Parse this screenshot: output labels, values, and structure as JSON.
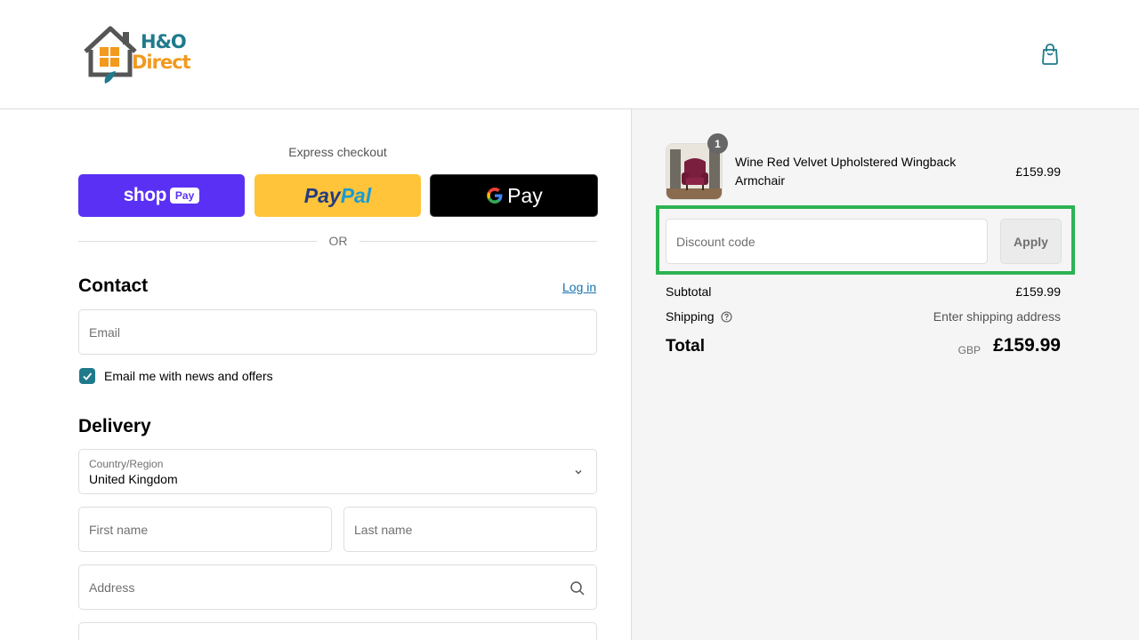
{
  "brand": {
    "line1": "H&O",
    "line2": "Direct",
    "colors": {
      "primary": "#1f7a8c",
      "accent": "#f29a1f"
    }
  },
  "header": {
    "cart_icon": "shopping-bag-icon"
  },
  "express": {
    "label": "Express checkout",
    "shop_pay": {
      "word": "shop",
      "badge": "Pay"
    },
    "paypal": {
      "part1": "Pay",
      "part2": "Pal"
    },
    "gpay": {
      "g": "G",
      "word": "Pay"
    },
    "divider": "OR"
  },
  "contact": {
    "title": "Contact",
    "login_link": "Log in",
    "email_placeholder": "Email",
    "newsletter_label": "Email me with news and offers",
    "newsletter_checked": true
  },
  "delivery": {
    "title": "Delivery",
    "country_label": "Country/Region",
    "country_value": "United Kingdom",
    "first_name_placeholder": "First name",
    "last_name_placeholder": "Last name",
    "address_placeholder": "Address"
  },
  "order": {
    "item": {
      "quantity": "1",
      "name": "Wine Red Velvet Upholstered Wingback Armchair",
      "price": "£159.99"
    },
    "discount": {
      "placeholder": "Discount code",
      "apply_label": "Apply"
    },
    "subtotal": {
      "label": "Subtotal",
      "value": "£159.99"
    },
    "shipping": {
      "label": "Shipping",
      "value": "Enter shipping address"
    },
    "total": {
      "label": "Total",
      "currency": "GBP",
      "value": "£159.99"
    }
  }
}
